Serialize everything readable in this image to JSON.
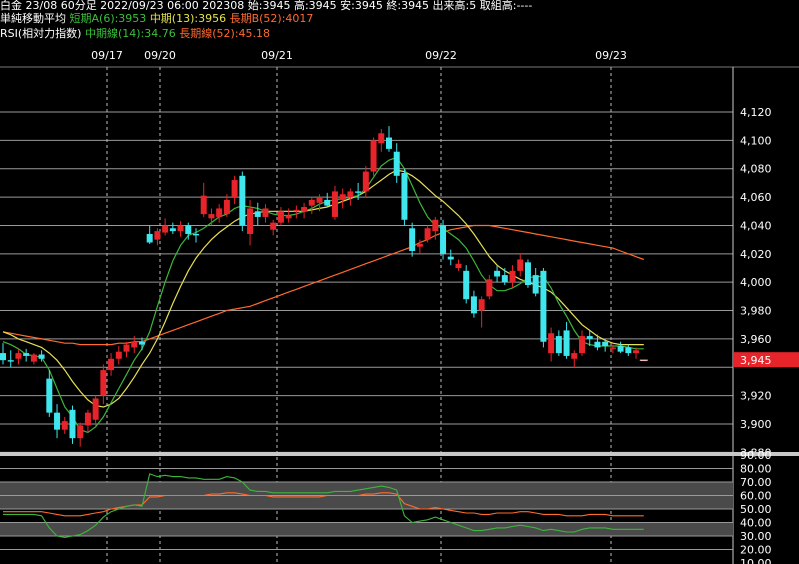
{
  "header": {
    "line1": "白金 23/08 60分足 2022/09/23 06:00 202308 始:3945 高:3945 安:3945 終:3945 出来高:5 取組高:----",
    "ma_title": "単純移動平均",
    "ma_short": "短期A(6):3953",
    "ma_mid": "中期(13):3956",
    "ma_long": "長期B(52):4017",
    "rsi_title": "RSI(相対力指数)",
    "rsi_mid": "中期線(14):34.76",
    "rsi_long": "長期線(52):45.18"
  },
  "colors": {
    "up": "#e8242b",
    "down": "#3fe6ee",
    "ma_short": "#3cb63c",
    "ma_mid": "#e6e055",
    "ma_long": "#ff6a2e",
    "rsi_mid": "#3cb63c",
    "rsi_long": "#ff6a2e",
    "last_price_bg": "#e8242b"
  },
  "chart_data": [
    {
      "type": "candlestick",
      "x_labels": [
        "09/17",
        "09/20",
        "09/21",
        "09/22",
        "09/23"
      ],
      "ylim": [
        3860,
        4130
      ],
      "y_ticks": [
        "4,120",
        "4,100",
        "4,080",
        "4,060",
        "4,040",
        "4,020",
        "4,000",
        "3,980",
        "3,960",
        "3,945",
        "3,920",
        "3,900",
        "3,880"
      ],
      "last_price": "3,945",
      "candles": [
        {
          "o": 3950,
          "h": 3957,
          "l": 3942,
          "c": 3945
        },
        {
          "o": 3945,
          "h": 3952,
          "l": 3940,
          "c": 3944
        },
        {
          "o": 3946,
          "h": 3953,
          "l": 3942,
          "c": 3950
        },
        {
          "o": 3950,
          "h": 3953,
          "l": 3944,
          "c": 3948
        },
        {
          "o": 3944,
          "h": 3950,
          "l": 3942,
          "c": 3949
        },
        {
          "o": 3949,
          "h": 3952,
          "l": 3944,
          "c": 3946
        },
        {
          "o": 3932,
          "h": 3938,
          "l": 3905,
          "c": 3908
        },
        {
          "o": 3908,
          "h": 3914,
          "l": 3890,
          "c": 3896
        },
        {
          "o": 3896,
          "h": 3905,
          "l": 3893,
          "c": 3902
        },
        {
          "o": 3910,
          "h": 3913,
          "l": 3886,
          "c": 3890
        },
        {
          "o": 3890,
          "h": 3901,
          "l": 3884,
          "c": 3899
        },
        {
          "o": 3899,
          "h": 3910,
          "l": 3894,
          "c": 3908
        },
        {
          "o": 3903,
          "h": 3920,
          "l": 3899,
          "c": 3918
        },
        {
          "o": 3920,
          "h": 3942,
          "l": 3914,
          "c": 3938
        },
        {
          "o": 3938,
          "h": 3950,
          "l": 3934,
          "c": 3946
        },
        {
          "o": 3946,
          "h": 3955,
          "l": 3942,
          "c": 3951
        },
        {
          "o": 3951,
          "h": 3958,
          "l": 3947,
          "c": 3956
        },
        {
          "o": 3954,
          "h": 3962,
          "l": 3950,
          "c": 3958
        },
        {
          "o": 3958,
          "h": 3961,
          "l": 3952,
          "c": 3956
        },
        {
          "o": 4034,
          "h": 4040,
          "l": 4027,
          "c": 4028
        },
        {
          "o": 4030,
          "h": 4038,
          "l": 4026,
          "c": 4036
        },
        {
          "o": 4035,
          "h": 4045,
          "l": 4033,
          "c": 4040
        },
        {
          "o": 4038,
          "h": 4042,
          "l": 4034,
          "c": 4036
        },
        {
          "o": 4036,
          "h": 4043,
          "l": 4032,
          "c": 4040
        },
        {
          "o": 4040,
          "h": 4042,
          "l": 4030,
          "c": 4034
        },
        {
          "o": 4034,
          "h": 4038,
          "l": 4028,
          "c": 4033
        },
        {
          "o": 4048,
          "h": 4070,
          "l": 4046,
          "c": 4061
        },
        {
          "o": 4045,
          "h": 4052,
          "l": 4040,
          "c": 4048
        },
        {
          "o": 4046,
          "h": 4055,
          "l": 4042,
          "c": 4052
        },
        {
          "o": 4048,
          "h": 4062,
          "l": 4046,
          "c": 4058
        },
        {
          "o": 4060,
          "h": 4075,
          "l": 4055,
          "c": 4072
        },
        {
          "o": 4075,
          "h": 4078,
          "l": 4036,
          "c": 4040
        },
        {
          "o": 4034,
          "h": 4058,
          "l": 4026,
          "c": 4052
        },
        {
          "o": 4050,
          "h": 4056,
          "l": 4040,
          "c": 4046
        },
        {
          "o": 4046,
          "h": 4055,
          "l": 4042,
          "c": 4052
        },
        {
          "o": 4037,
          "h": 4044,
          "l": 4033,
          "c": 4042
        },
        {
          "o": 4042,
          "h": 4053,
          "l": 4040,
          "c": 4050
        },
        {
          "o": 4045,
          "h": 4052,
          "l": 4042,
          "c": 4047
        },
        {
          "o": 4050,
          "h": 4054,
          "l": 4045,
          "c": 4051
        },
        {
          "o": 4050,
          "h": 4056,
          "l": 4045,
          "c": 4053
        },
        {
          "o": 4054,
          "h": 4060,
          "l": 4048,
          "c": 4058
        },
        {
          "o": 4056,
          "h": 4062,
          "l": 4050,
          "c": 4060
        },
        {
          "o": 4058,
          "h": 4063,
          "l": 4053,
          "c": 4054
        },
        {
          "o": 4046,
          "h": 4068,
          "l": 4044,
          "c": 4064
        },
        {
          "o": 4058,
          "h": 4066,
          "l": 4052,
          "c": 4062
        },
        {
          "o": 4060,
          "h": 4066,
          "l": 4054,
          "c": 4064
        },
        {
          "o": 4064,
          "h": 4070,
          "l": 4058,
          "c": 4063
        },
        {
          "o": 4064,
          "h": 4082,
          "l": 4060,
          "c": 4078
        },
        {
          "o": 4078,
          "h": 4102,
          "l": 4075,
          "c": 4100
        },
        {
          "o": 4098,
          "h": 4108,
          "l": 4092,
          "c": 4105
        },
        {
          "o": 4102,
          "h": 4110,
          "l": 4092,
          "c": 4094
        },
        {
          "o": 4092,
          "h": 4098,
          "l": 4070,
          "c": 4075
        },
        {
          "o": 4077,
          "h": 4080,
          "l": 4040,
          "c": 4044
        },
        {
          "o": 4038,
          "h": 4042,
          "l": 4018,
          "c": 4022
        },
        {
          "o": 4025,
          "h": 4030,
          "l": 4020,
          "c": 4027
        },
        {
          "o": 4030,
          "h": 4040,
          "l": 4028,
          "c": 4038
        },
        {
          "o": 4036,
          "h": 4046,
          "l": 4030,
          "c": 4044
        },
        {
          "o": 4040,
          "h": 4044,
          "l": 4016,
          "c": 4020
        },
        {
          "o": 4018,
          "h": 4023,
          "l": 4012,
          "c": 4016
        },
        {
          "o": 4010,
          "h": 4016,
          "l": 4008,
          "c": 4013
        },
        {
          "o": 4008,
          "h": 4012,
          "l": 3985,
          "c": 3988
        },
        {
          "o": 3990,
          "h": 3994,
          "l": 3975,
          "c": 3978
        },
        {
          "o": 3980,
          "h": 3990,
          "l": 3968,
          "c": 3988
        },
        {
          "o": 3990,
          "h": 4005,
          "l": 3988,
          "c": 4002
        },
        {
          "o": 4008,
          "h": 4012,
          "l": 4000,
          "c": 4004
        },
        {
          "o": 4005,
          "h": 4010,
          "l": 3998,
          "c": 4000
        },
        {
          "o": 4000,
          "h": 4012,
          "l": 3996,
          "c": 4008
        },
        {
          "o": 4008,
          "h": 4020,
          "l": 4004,
          "c": 4016
        },
        {
          "o": 4014,
          "h": 4016,
          "l": 3996,
          "c": 3998
        },
        {
          "o": 4005,
          "h": 4010,
          "l": 3990,
          "c": 3992
        },
        {
          "o": 4008,
          "h": 4010,
          "l": 3954,
          "c": 3958
        },
        {
          "o": 3950,
          "h": 3968,
          "l": 3944,
          "c": 3964
        },
        {
          "o": 3962,
          "h": 3966,
          "l": 3948,
          "c": 3950
        },
        {
          "o": 3966,
          "h": 3972,
          "l": 3946,
          "c": 3948
        },
        {
          "o": 3946,
          "h": 3952,
          "l": 3940,
          "c": 3950
        },
        {
          "o": 3950,
          "h": 3966,
          "l": 3948,
          "c": 3962
        },
        {
          "o": 3962,
          "h": 3966,
          "l": 3955,
          "c": 3960
        },
        {
          "o": 3958,
          "h": 3963,
          "l": 3952,
          "c": 3954
        },
        {
          "o": 3958,
          "h": 3960,
          "l": 3951,
          "c": 3955
        },
        {
          "o": 3953,
          "h": 3956,
          "l": 3950,
          "c": 3954
        },
        {
          "o": 3955,
          "h": 3958,
          "l": 3950,
          "c": 3951
        },
        {
          "o": 3954,
          "h": 3956,
          "l": 3948,
          "c": 3950
        },
        {
          "o": 3950,
          "h": 3954,
          "l": 3946,
          "c": 3952
        },
        {
          "o": 3945,
          "h": 3945,
          "l": 3945,
          "c": 3945
        }
      ],
      "ma_short_values": [
        3958,
        3956,
        3953,
        3949,
        3948,
        3947,
        3938,
        3925,
        3912,
        3905,
        3896,
        3894,
        3898,
        3905,
        3915,
        3925,
        3935,
        3945,
        3953,
        3965,
        3983,
        4000,
        4015,
        4026,
        4033,
        4035,
        4038,
        4042,
        4046,
        4048,
        4052,
        4054,
        4053,
        4052,
        4050,
        4048,
        4047,
        4047,
        4048,
        4050,
        4052,
        4055,
        4057,
        4058,
        4059,
        4060,
        4061,
        4066,
        4074,
        4082,
        4086,
        4088,
        4080,
        4068,
        4056,
        4046,
        4040,
        4038,
        4034,
        4030,
        4024,
        4015,
        4005,
        3998,
        3994,
        3994,
        3996,
        3999,
        4003,
        4004,
        4004,
        3996,
        3985,
        3976,
        3966,
        3958,
        3956,
        3955,
        3955,
        3955,
        3955,
        3954,
        3953,
        3953
      ],
      "ma_mid_values": [
        3965,
        3963,
        3960,
        3958,
        3956,
        3954,
        3950,
        3945,
        3938,
        3930,
        3923,
        3917,
        3913,
        3912,
        3914,
        3918,
        3925,
        3933,
        3942,
        3950,
        3960,
        3972,
        3985,
        3997,
        4008,
        4017,
        4024,
        4030,
        4035,
        4039,
        4043,
        4046,
        4048,
        4049,
        4050,
        4050,
        4050,
        4050,
        4050,
        4050,
        4051,
        4052,
        4053,
        4055,
        4057,
        4059,
        4061,
        4064,
        4068,
        4072,
        4076,
        4079,
        4078,
        4075,
        4071,
        4066,
        4061,
        4057,
        4052,
        4047,
        4041,
        4034,
        4026,
        4018,
        4012,
        4008,
        4005,
        4002,
        4000,
        3998,
        3996,
        3993,
        3988,
        3982,
        3976,
        3970,
        3966,
        3962,
        3959,
        3957,
        3956,
        3956,
        3956,
        3956
      ],
      "ma_long_values": [
        3965,
        3964,
        3963,
        3962,
        3961,
        3960,
        3959,
        3958,
        3957,
        3957,
        3956,
        3956,
        3956,
        3956,
        3956,
        3957,
        3957,
        3958,
        3958,
        3960,
        3962,
        3964,
        3966,
        3968,
        3970,
        3972,
        3974,
        3976,
        3978,
        3980,
        3981,
        3982,
        3983,
        3985,
        3987,
        3989,
        3991,
        3993,
        3995,
        3997,
        3999,
        4001,
        4003,
        4005,
        4007,
        4009,
        4011,
        4013,
        4015,
        4017,
        4019,
        4021,
        4023,
        4025,
        4028,
        4030,
        4033,
        4035,
        4037,
        4038,
        4039,
        4040,
        4040,
        4040,
        4039,
        4038,
        4037,
        4036,
        4035,
        4034,
        4033,
        4032,
        4031,
        4030,
        4029,
        4028,
        4027,
        4026,
        4025,
        4024,
        4022,
        4020,
        4018,
        4016
      ]
    },
    {
      "type": "line",
      "ylim": [
        10,
        90
      ],
      "y_ticks": [
        "90.00",
        "80.00",
        "70.00",
        "60.00",
        "50.00",
        "40.00",
        "30.00",
        "20.00",
        "10.00"
      ],
      "series": [
        {
          "values": [
            46,
            46,
            46,
            46,
            46,
            45,
            36,
            30,
            29,
            30,
            31,
            34,
            38,
            44,
            48,
            50,
            52,
            53,
            52,
            76,
            74,
            75,
            74,
            74,
            73,
            73,
            72,
            72,
            72,
            74,
            73,
            70,
            64,
            63,
            63,
            62,
            62,
            62,
            62,
            62,
            62,
            62,
            62,
            63,
            63,
            63,
            64,
            65,
            66,
            67,
            66,
            64,
            45,
            40,
            41,
            42,
            44,
            42,
            40,
            38,
            36,
            34,
            34,
            35,
            36,
            36,
            37,
            38,
            37,
            36,
            34,
            35,
            34,
            33,
            33,
            35,
            36,
            36,
            36,
            35,
            35,
            35,
            35,
            35
          ]
        },
        {
          "values": [
            48,
            48,
            48,
            48,
            48,
            48,
            47,
            46,
            45,
            45,
            45,
            46,
            47,
            48,
            50,
            51,
            52,
            53,
            53,
            59,
            59,
            60,
            60,
            60,
            60,
            60,
            60,
            61,
            61,
            62,
            62,
            61,
            60,
            60,
            60,
            59,
            59,
            59,
            59,
            59,
            59,
            59,
            60,
            60,
            60,
            60,
            60,
            61,
            61,
            62,
            62,
            61,
            54,
            52,
            50,
            50,
            51,
            50,
            49,
            48,
            47,
            47,
            46,
            46,
            47,
            47,
            47,
            48,
            48,
            47,
            46,
            46,
            46,
            45,
            45,
            45,
            46,
            46,
            46,
            45,
            45,
            45,
            45,
            45
          ]
        }
      ]
    }
  ]
}
